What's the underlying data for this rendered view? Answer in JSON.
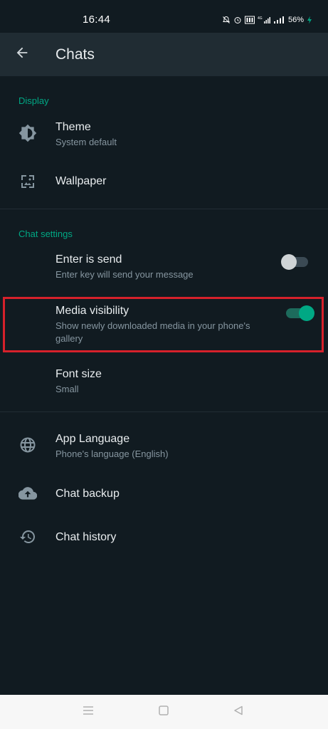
{
  "status_bar": {
    "time": "16:44",
    "battery": "56%",
    "network_label": "4G",
    "icons": [
      "mute-bell-icon",
      "alarm-icon",
      "volte-icon",
      "signal-4g-icon",
      "signal-icon",
      "battery-charging-icon"
    ]
  },
  "app_bar": {
    "title": "Chats",
    "back_icon": "arrow-left-icon"
  },
  "display": {
    "header": "Display",
    "theme": {
      "title": "Theme",
      "subtitle": "System default",
      "icon": "brightness-icon"
    },
    "wallpaper": {
      "title": "Wallpaper",
      "icon": "wallpaper-icon"
    }
  },
  "chat_settings": {
    "header": "Chat settings",
    "enter_is_send": {
      "title": "Enter is send",
      "subtitle": "Enter key will send your message",
      "enabled": false
    },
    "media_visibility": {
      "title": "Media visibility",
      "subtitle": "Show newly downloaded media in your phone's gallery",
      "enabled": true
    },
    "font_size": {
      "title": "Font size",
      "subtitle": "Small"
    }
  },
  "other": {
    "app_language": {
      "title": "App Language",
      "subtitle": "Phone's language (English)",
      "icon": "globe-icon"
    },
    "chat_backup": {
      "title": "Chat backup",
      "icon": "cloud-upload-icon"
    },
    "chat_history": {
      "title": "Chat history",
      "icon": "history-icon"
    }
  },
  "colors": {
    "accent": "#00a884",
    "background": "#111b21",
    "app_bar": "#202c33",
    "highlight": "#d6212b"
  },
  "nav_bar": {
    "icons": [
      "menu-icon",
      "home-square-icon",
      "back-triangle-icon"
    ]
  }
}
